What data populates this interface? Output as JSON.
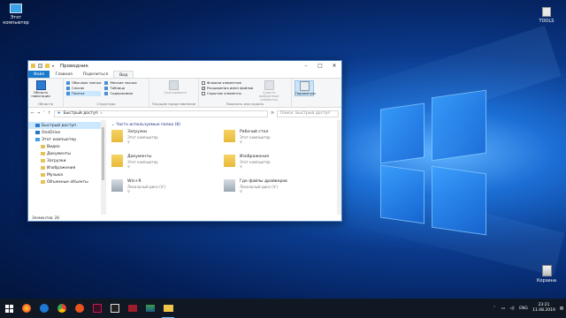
{
  "desktop": {
    "computer_icon_label": "Этот компьютер",
    "tools_icon_label": "TOOLS",
    "recycle_icon_label": "Корзина"
  },
  "window": {
    "title": "Проводник",
    "ribbon_tabs": [
      "Файл",
      "Главная",
      "Поделиться",
      "Вид"
    ],
    "ribbon": {
      "nav_pane_label": "Область навигации",
      "panes_group": "Области",
      "layout_items": [
        "Обычные значки",
        "Мелкие значки",
        "Список",
        "Таблица",
        "Плитка",
        "Содержимое"
      ],
      "layout_group": "Структура",
      "sort_label": "Сортировать",
      "current_view_group": "Текущее представление",
      "checkboxes": [
        {
          "label": "Флажки элементов",
          "checked": false
        },
        {
          "label": "Расширения имен файлов",
          "checked": true
        },
        {
          "label": "Скрытые элементы",
          "checked": false
        }
      ],
      "hide_selected_label": "Скрыть выбранные элементы",
      "show_hide_group": "Показать или скрыть",
      "options_label": "Параметры"
    },
    "address": {
      "path": "Быстрый доступ",
      "search_placeholder": "Поиск: Быстрый доступ"
    },
    "nav": [
      {
        "label": "Быстрый доступ",
        "icon": "star-icon",
        "selected": true,
        "sub": false
      },
      {
        "label": "OneDrive",
        "icon": "cloud-icon",
        "selected": false,
        "sub": false
      },
      {
        "label": "Этот компьютер",
        "icon": "computer-icon",
        "selected": false,
        "sub": false
      },
      {
        "label": "Видео",
        "icon": "video-folder-icon",
        "selected": false,
        "sub": true
      },
      {
        "label": "Документы",
        "icon": "documents-folder-icon",
        "selected": false,
        "sub": true
      },
      {
        "label": "Загрузки",
        "icon": "downloads-folder-icon",
        "selected": false,
        "sub": true
      },
      {
        "label": "Изображения",
        "icon": "pictures-folder-icon",
        "selected": false,
        "sub": true
      },
      {
        "label": "Музыка",
        "icon": "music-folder-icon",
        "selected": false,
        "sub": true
      },
      {
        "label": "Объемные объекты",
        "icon": "3d-objects-icon",
        "selected": false,
        "sub": true
      }
    ],
    "main": {
      "section_header": "Часто используемые папки (8)",
      "folders": [
        {
          "name": "Загрузки",
          "sub": "Этот компьютер",
          "icon": "downloads-folder-icon"
        },
        {
          "name": "Рабочий стол",
          "sub": "Этот компьютер",
          "icon": "desktop-folder-icon"
        },
        {
          "name": "Документы",
          "sub": "Этот компьютер",
          "icon": "documents-folder-icon"
        },
        {
          "name": "Изображения",
          "sub": "Этот компьютер",
          "icon": "pictures-folder-icon"
        },
        {
          "name": "Win+R",
          "sub": "Локальный диск (V:)",
          "icon": "folder-icon"
        },
        {
          "name": "Где файлы драйверов",
          "sub": "Локальный диск (V:)",
          "icon": "folder-icon"
        }
      ]
    },
    "status": "Элементов: 28"
  },
  "taskbar": {
    "language": "ENG",
    "time": "23:21",
    "date": "11.08.2019"
  },
  "colors": {
    "accent": "#1979ca",
    "taskbar": "#101923",
    "selection": "#cce8ff"
  }
}
